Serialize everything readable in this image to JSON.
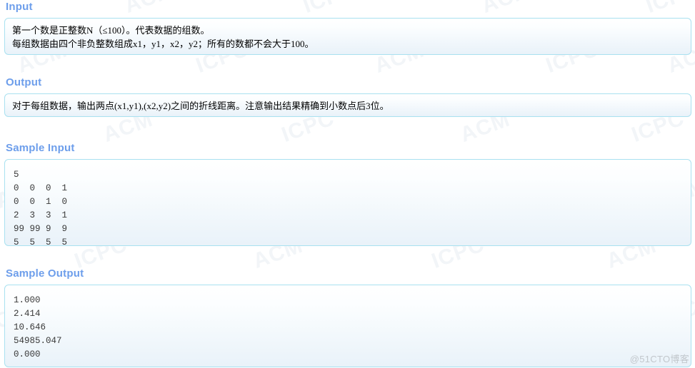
{
  "page": {
    "site_watermark": "@51CTO博客",
    "background_watermarks": [
      "ACM",
      "ICPC"
    ],
    "heading_color": "#6d9eeb",
    "panel_border_color": "#a9e1f0",
    "panel_background_color": "#e9f2f9",
    "body_text_color": "#000000"
  },
  "sections": {
    "input": {
      "heading": "Input",
      "lines": [
        "第一个数是正整数N（≤100）。代表数据的组数。",
        "每组数据由四个非负整数组成x1，y1，x2，y2；所有的数都不会大于100。"
      ]
    },
    "output": {
      "heading": "Output",
      "lines": [
        "对于每组数据，输出两点(x1,y1),(x2,y2)之间的折线距离。注意输出结果精确到小数点后3位。"
      ]
    },
    "sample_input": {
      "heading": "Sample Input",
      "text": "5\n0  0  0  1\n0  0  1  0\n2  3  3  1\n99 99 9  9\n5  5  5  5"
    },
    "sample_output": {
      "heading": "Sample Output",
      "text": "1.000\n2.414\n10.646\n54985.047\n0.000"
    }
  }
}
